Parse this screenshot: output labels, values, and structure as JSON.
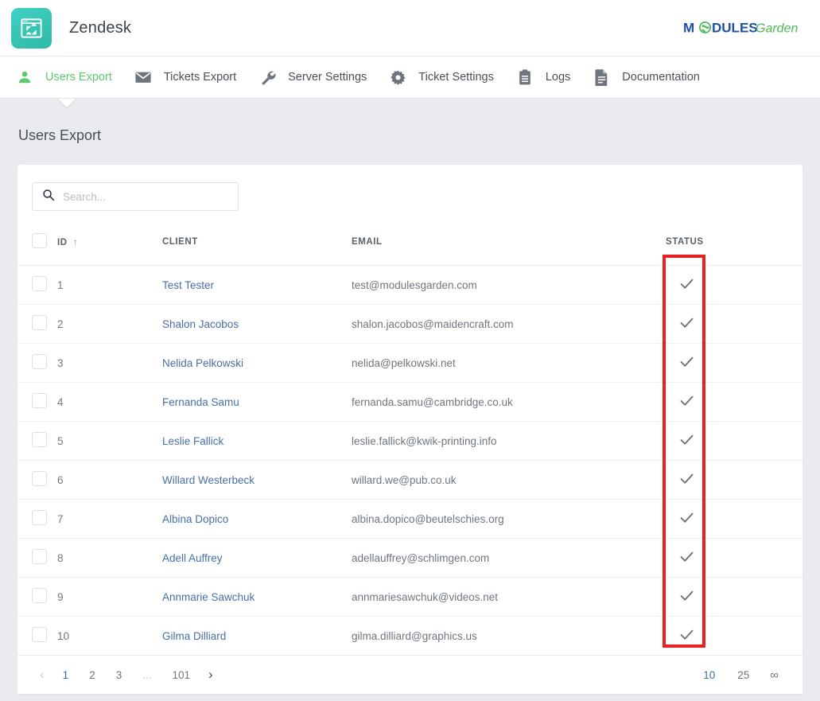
{
  "header": {
    "app_title": "Zendesk",
    "app_icon": "zendesk-logo-icon",
    "vendor_logo": {
      "prefix": "M",
      "globe": "globe-o-icon",
      "middle": "DULES",
      "suffix": "Garden",
      "blue": "#1f4fa0",
      "green": "#4eb857"
    }
  },
  "nav": {
    "items": [
      {
        "label": "Users Export",
        "icon": "user-icon",
        "active": true
      },
      {
        "label": "Tickets Export",
        "icon": "envelope-icon",
        "active": false
      },
      {
        "label": "Server Settings",
        "icon": "wrench-icon",
        "active": false
      },
      {
        "label": "Ticket Settings",
        "icon": "gear-icon",
        "active": false
      },
      {
        "label": "Logs",
        "icon": "clipboard-icon",
        "active": false
      },
      {
        "label": "Documentation",
        "icon": "document-icon",
        "active": false
      }
    ],
    "active_color": "#5dc96a"
  },
  "page": {
    "title": "Users Export"
  },
  "search": {
    "placeholder": "Search...",
    "value": "",
    "icon": "search-icon"
  },
  "table": {
    "columns": [
      {
        "key": "check",
        "label": ""
      },
      {
        "key": "id",
        "label": "ID",
        "sort": "asc",
        "sort_glyph": "↑"
      },
      {
        "key": "client",
        "label": "CLIENT"
      },
      {
        "key": "email",
        "label": "EMAIL"
      },
      {
        "key": "status",
        "label": "STATUS"
      }
    ],
    "status_glyph": "✓",
    "rows": [
      {
        "id": "1",
        "client": "Test Tester",
        "email": "test@modulesgarden.com",
        "status": "ok"
      },
      {
        "id": "2",
        "client": "Shalon Jacobos",
        "email": "shalon.jacobos@maidencraft.com",
        "status": "ok"
      },
      {
        "id": "3",
        "client": "Nelida Pelkowski",
        "email": "nelida@pelkowski.net",
        "status": "ok"
      },
      {
        "id": "4",
        "client": "Fernanda Samu",
        "email": "fernanda.samu@cambridge.co.uk",
        "status": "ok"
      },
      {
        "id": "5",
        "client": "Leslie Fallick",
        "email": "leslie.fallick@kwik-printing.info",
        "status": "ok"
      },
      {
        "id": "6",
        "client": "Willard Westerbeck",
        "email": "willard.we@pub.co.uk",
        "status": "ok"
      },
      {
        "id": "7",
        "client": "Albina Dopico",
        "email": "albina.dopico@beutelschies.org",
        "status": "ok"
      },
      {
        "id": "8",
        "client": "Adell Auffrey",
        "email": "adellauffrey@schlimgen.com",
        "status": "ok"
      },
      {
        "id": "9",
        "client": "Annmarie Sawchuk",
        "email": "annmariesawchuk@videos.net",
        "status": "ok"
      },
      {
        "id": "10",
        "client": "Gilma Dilliard",
        "email": "gilma.dilliard@graphics.us",
        "status": "ok"
      }
    ]
  },
  "pagination": {
    "prev_glyph": "‹",
    "next_glyph": "›",
    "pages": [
      "1",
      "2",
      "3",
      "...",
      "101"
    ],
    "current_page": "1",
    "page_sizes": [
      "10",
      "25"
    ],
    "current_size": "10",
    "infinite_glyph": "∞"
  },
  "annotation": {
    "color": "#e8201f",
    "target": "status-column"
  }
}
